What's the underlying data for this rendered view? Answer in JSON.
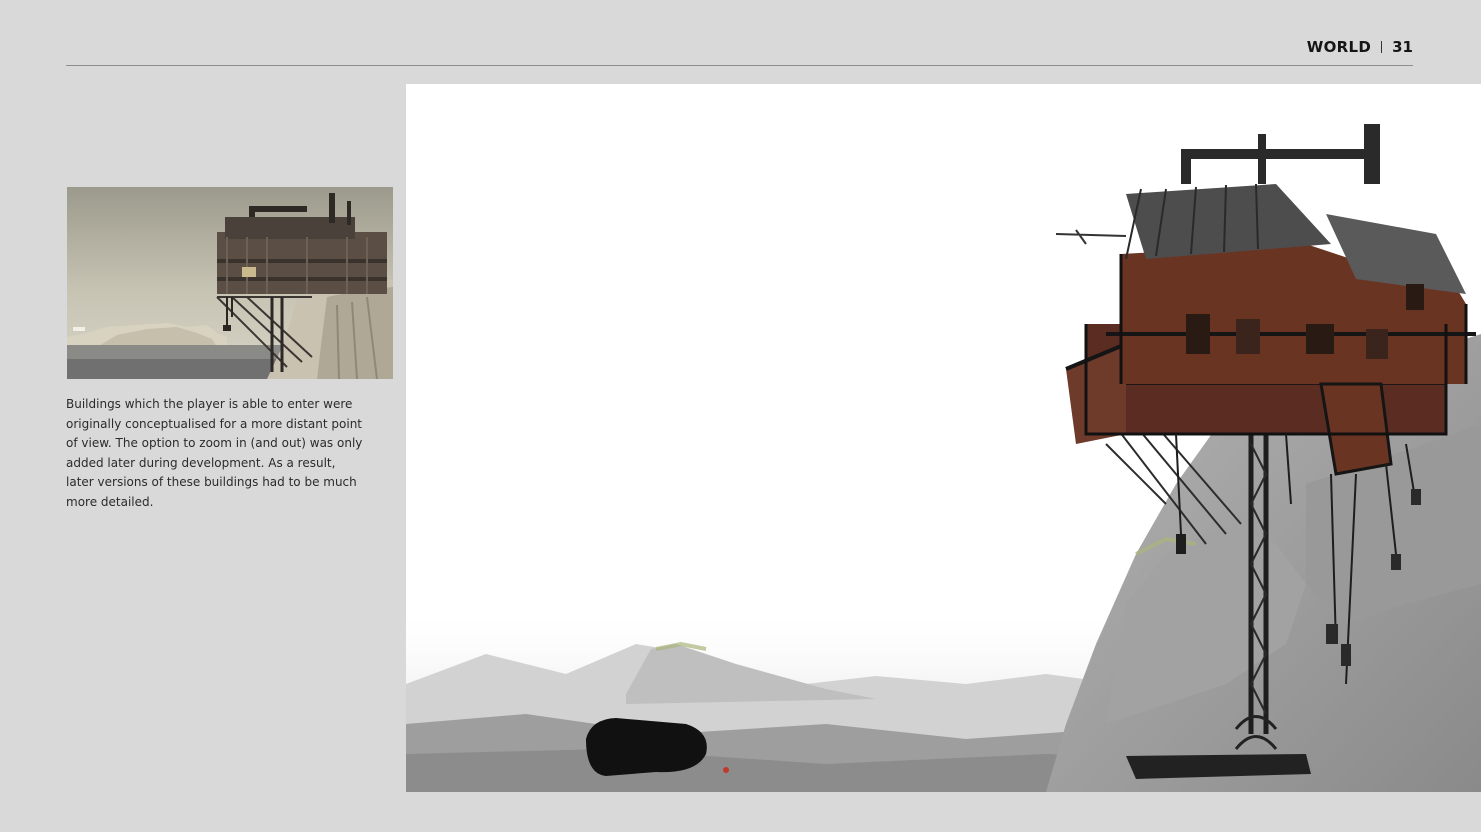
{
  "header": {
    "section": "WORLD",
    "page_number": "31"
  },
  "caption": {
    "text": "Buildings which the player is able to enter were originally conceptualised for a more distant point of view. The option to zoom in (and out) was only added later during development. As a result, later versions of these buildings had to be much more detailed."
  },
  "colors": {
    "background": "#d9d9d9",
    "rule": "#8e8e8e",
    "text": "#2b2b2b",
    "rust": "#6e3a2a"
  }
}
